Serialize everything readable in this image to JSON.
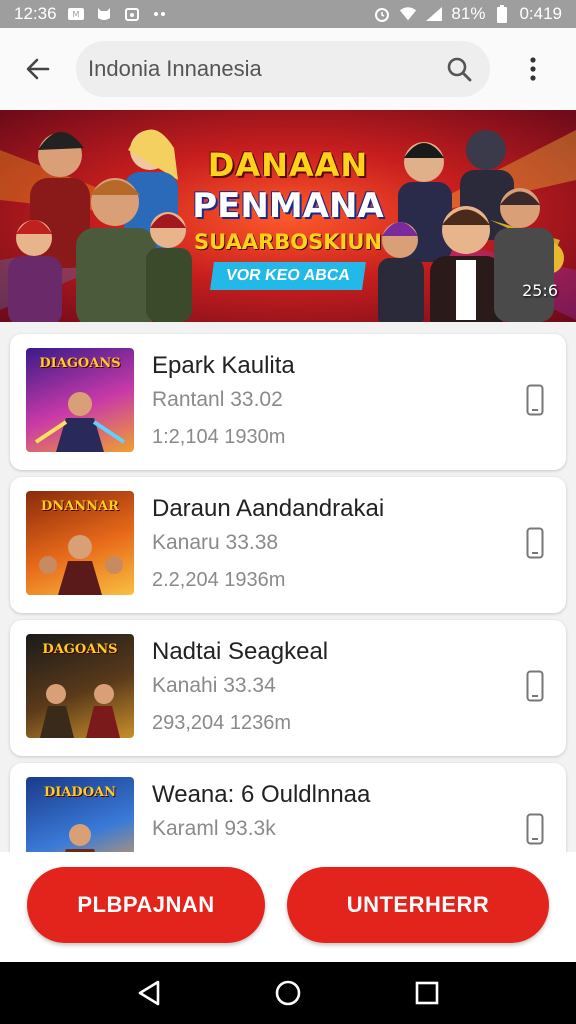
{
  "status_bar": {
    "time_left": "12:36",
    "battery": "81%",
    "time_right": "0:419",
    "icons": [
      "notification-icon",
      "cat-icon",
      "calendar-icon",
      "dots-icon",
      "alarm-icon",
      "wifi-icon",
      "signal-icon",
      "battery-icon"
    ]
  },
  "header": {
    "search_text": "Indonia  Innanesia",
    "icons": [
      "back-arrow-icon",
      "search-icon",
      "more-vert-icon"
    ]
  },
  "banner": {
    "line1": "DANAAN",
    "line2": "PENMANA",
    "line3": "SUAARBOSKIUN",
    "line4": "VOR KEO ABCA",
    "timestamp": "25:6"
  },
  "items": [
    {
      "thumb_label": "DIAGOANS",
      "name": "Epark Kaulita",
      "line2": "Rantanl 33.02",
      "line3": "1:2,104  1930m"
    },
    {
      "thumb_label": "DNANNAR",
      "name": "Daraun Aandandrakai",
      "line2": "Kanaru 33.38",
      "line3": "2.2,204  1936m"
    },
    {
      "thumb_label": "DAGOANS",
      "name": "Nadtai Seagkeal",
      "line2": "Kanahi 33.34",
      "line3": "293,204  1236m"
    },
    {
      "thumb_label": "DIADOAN",
      "name": "Weana: 6 Ouldlnnaa",
      "line2": "Karaml 93.3k",
      "line3": ""
    }
  ],
  "actions": {
    "left_label": "PLBPAJNAN",
    "right_label": "UNTERHERR",
    "accent": "#e3241c"
  },
  "nav": {
    "icons": [
      "back-triangle-icon",
      "home-circle-icon",
      "recents-square-icon"
    ]
  }
}
